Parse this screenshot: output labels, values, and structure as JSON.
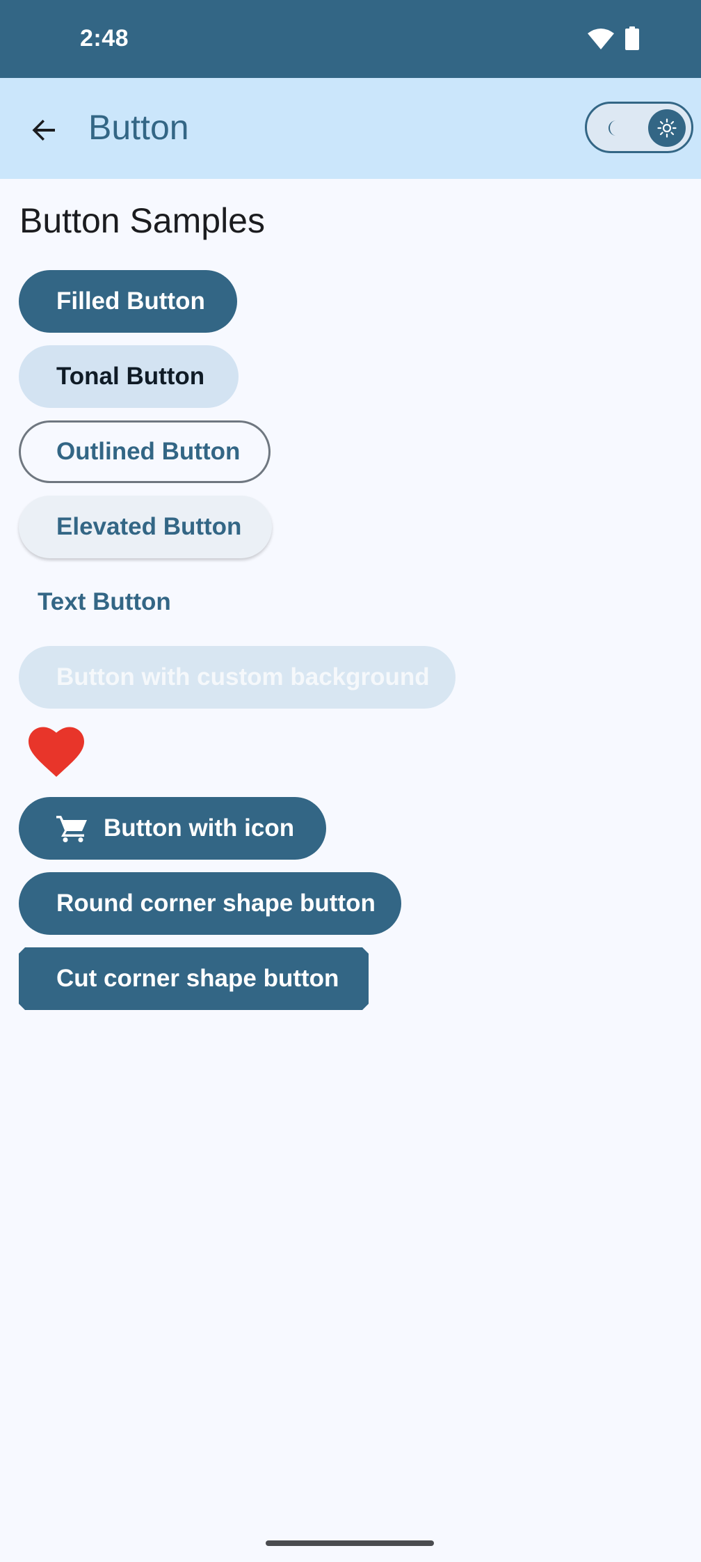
{
  "status_bar": {
    "time": "2:48",
    "wifi_icon": "wifi-icon",
    "battery_icon": "battery-icon"
  },
  "app_bar": {
    "back_icon": "arrow-back-icon",
    "title": "Button",
    "theme_toggle": {
      "left_icon": "moon-icon",
      "right_icon": "sun-icon",
      "selected": "light"
    }
  },
  "main": {
    "section_title": "Button Samples",
    "buttons": {
      "filled": "Filled Button",
      "tonal": "Tonal Button",
      "outlined": "Outlined Button",
      "elevated": "Elevated Button",
      "text": "Text Button",
      "custom_background": "Button with custom background",
      "heart_icon": "heart-icon",
      "with_icon": "Button with icon",
      "with_icon_icon": "shopping-cart-icon",
      "round_corner": "Round corner shape button",
      "cut_corner": "Cut corner shape button"
    }
  },
  "colors": {
    "primary": "#336685",
    "status_bar": "#336685",
    "app_bar": "#cbe6fb",
    "background": "#f7f9ff",
    "tonal": "#d3e3f2",
    "heart": "#e8352a"
  }
}
